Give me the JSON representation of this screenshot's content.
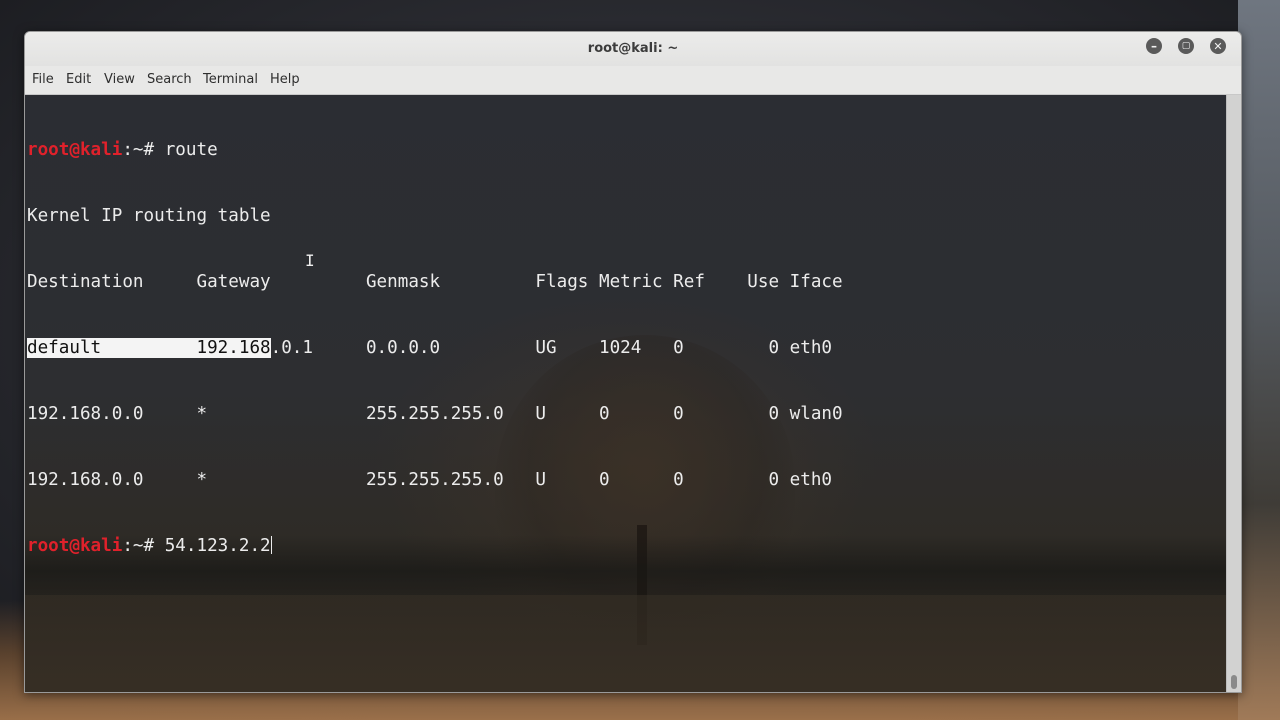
{
  "window": {
    "title": "root@kali: ~",
    "buttons": {
      "minimize": "–",
      "maximize": "▢",
      "close": "✕"
    }
  },
  "menu": [
    "File",
    "Edit",
    "View",
    "Search",
    "Terminal",
    "Help"
  ],
  "prompt": {
    "user": "root@kali",
    "rest": ":~# "
  },
  "terminal": {
    "command1": "route",
    "table_title": "Kernel IP routing table",
    "header": "Destination     Gateway         Genmask         Flags Metric Ref    Use Iface",
    "row1": {
      "selected": "default         192.168",
      "rest": ".0.1     0.0.0.0         UG    1024   0        0 eth0"
    },
    "rows": [
      "192.168.0.0     *               255.255.255.0   U     0      0        0 wlan0",
      "192.168.0.0     *               255.255.255.0   U     0      0        0 eth0"
    ],
    "current_input": "54.123.2.2"
  },
  "mouse_cursor_glyph": "I"
}
